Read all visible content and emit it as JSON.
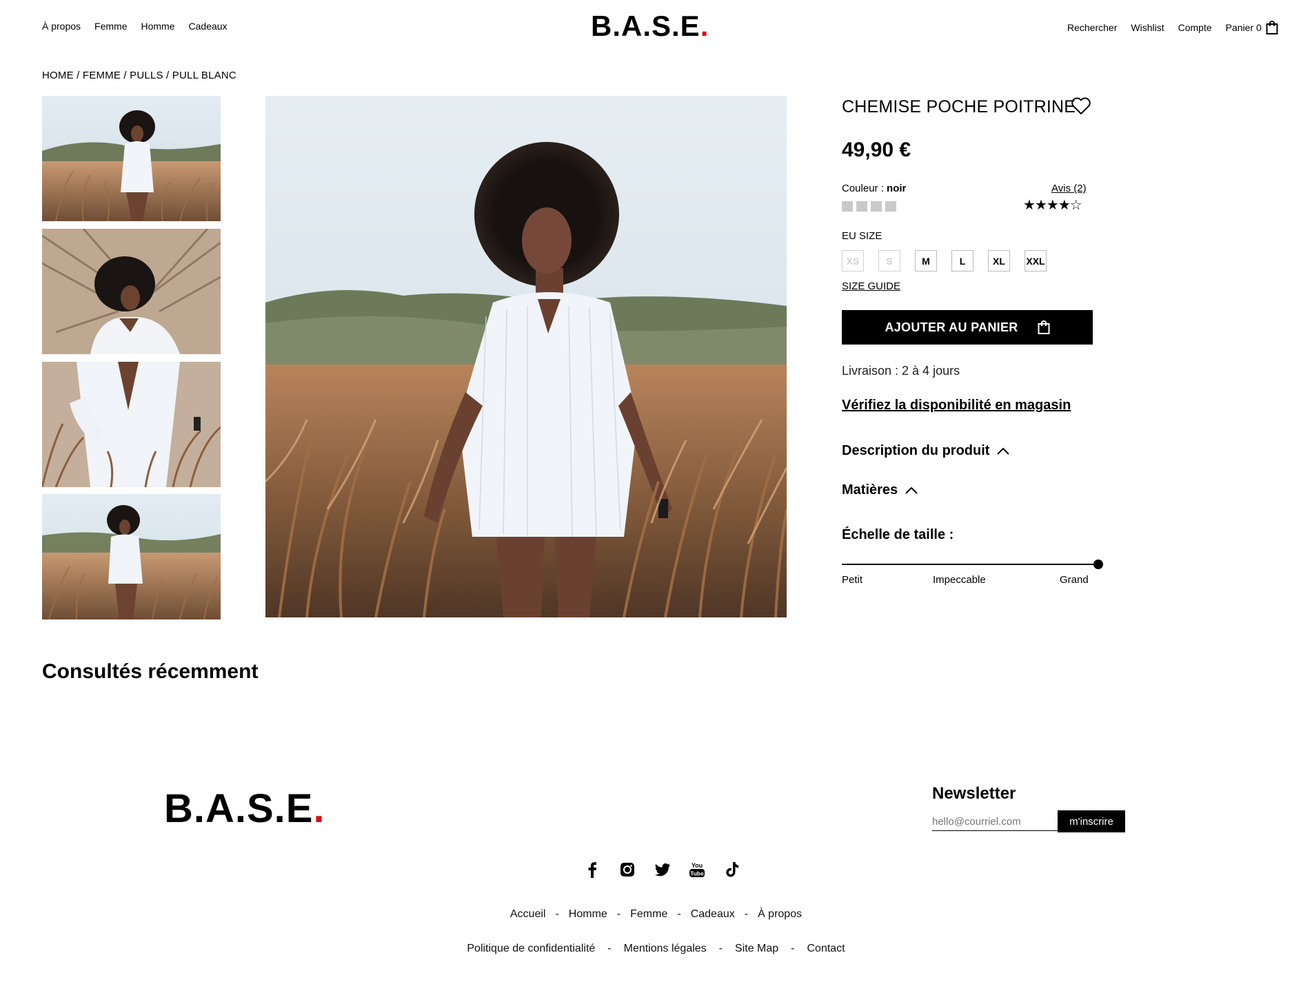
{
  "header": {
    "left_nav": [
      "À propos",
      "Femme",
      "Homme",
      "Cadeaux"
    ],
    "logo_text": "B.A.S.E",
    "logo_dot": ".",
    "right_nav": [
      "Rechercher",
      "Wishlist",
      "Compte",
      "Panier 0"
    ],
    "icons": {
      "cart": "shopping-bag-icon"
    }
  },
  "breadcrumb": "HOME / FEMME / PULLS / PULL BLANC",
  "gallery": {
    "thumbnails": [
      "thumb-1",
      "thumb-2",
      "thumb-3",
      "thumb-4"
    ]
  },
  "product": {
    "title": "CHEMISE POCHE POITRINE",
    "price": "49,90 €",
    "color_label": "Couleur : ",
    "color_value": "noir",
    "reviews_label": "Avis (2)",
    "rating": 4,
    "rating_max": 5,
    "size_label": "EU SIZE",
    "sizes": [
      {
        "label": "XS",
        "available": false
      },
      {
        "label": "S",
        "available": false
      },
      {
        "label": "M",
        "available": true
      },
      {
        "label": "L",
        "available": true
      },
      {
        "label": "XL",
        "available": true
      },
      {
        "label": "XXL",
        "available": true
      }
    ],
    "size_guide": "SIZE GUIDE",
    "add_to_cart": "AJOUTER AU PANIER",
    "delivery": "Livraison : 2 à 4 jours",
    "store_check": "Vérifiez la disponibilité en magasin",
    "description_label": "Description du produit",
    "materials_label": "Matières",
    "scale_label": "Échelle de taille :",
    "scale": {
      "labels": [
        "Petit",
        "Impeccable",
        "Grand"
      ],
      "value": 1.0
    }
  },
  "recent_title": "Consultés récemment",
  "footer": {
    "logo_text": "B.A.S.E",
    "logo_dot": ".",
    "newsletter_title": "Newsletter",
    "newsletter_placeholder": "hello@courriel.com",
    "newsletter_button": "m'inscrire",
    "social": [
      "facebook-icon",
      "instagram-icon",
      "twitter-icon",
      "youtube-icon",
      "tiktok-icon"
    ],
    "nav1": [
      "Accueil",
      "Homme",
      "Femme",
      "Cadeaux",
      "À propos"
    ],
    "nav2": [
      "Politique de confidentialité",
      "Mentions légales",
      "Site Map",
      "Contact"
    ],
    "separator": "-"
  },
  "colors": {
    "accent": "#e30613",
    "primary": "#000000"
  }
}
